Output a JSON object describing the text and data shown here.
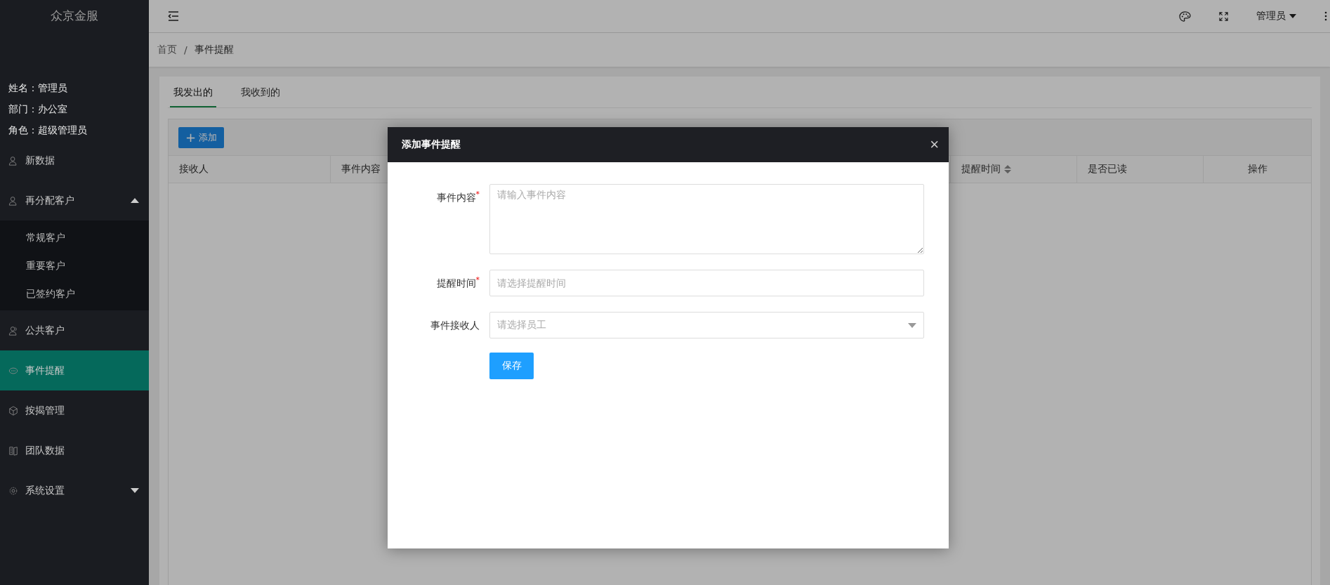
{
  "app": {
    "title": "众京金服"
  },
  "user_info": [
    {
      "label": "姓名：",
      "value": "管理员"
    },
    {
      "label": "部门：",
      "value": "办公室"
    },
    {
      "label": "角色：",
      "value": "超级管理员"
    }
  ],
  "menu": [
    {
      "label": "新数据",
      "selected": false
    },
    {
      "label": "再分配客户",
      "selected": false,
      "expanded": true,
      "children": [
        {
          "label": "常规客户",
          "selected": false
        },
        {
          "label": "重要客户",
          "selected": false
        },
        {
          "label": "已签约客户",
          "selected": false
        }
      ]
    },
    {
      "label": "公共客户",
      "selected": false
    },
    {
      "label": "事件提醒",
      "selected": true
    },
    {
      "label": "按揭管理",
      "selected": false
    },
    {
      "label": "团队数据",
      "selected": false
    },
    {
      "label": "系统设置",
      "selected": false,
      "expanded": false
    }
  ],
  "topbar": {
    "user": "管理员"
  },
  "breadcrumb": {
    "separator": "/",
    "items": [
      "首页",
      "事件提醒"
    ]
  },
  "tabs": [
    {
      "label": "我发出的",
      "selected": true
    },
    {
      "label": "我收到的",
      "selected": false
    }
  ],
  "add_button": {
    "icon": "+",
    "label": "添加"
  },
  "table": {
    "columns": [
      {
        "label": "接收人",
        "sortable": false
      },
      {
        "label": "事件内容",
        "sortable": false
      },
      {
        "label": "提醒时间",
        "sortable": true
      },
      {
        "label": "是否已读",
        "sortable": false
      },
      {
        "label": "操作",
        "sortable": false
      }
    ]
  },
  "modal": {
    "title": "添加事件提醒",
    "close": "×",
    "required_mark": "*",
    "fields": [
      {
        "kind": "textarea",
        "label": "事件内容",
        "required": true,
        "placeholder": "请输入事件内容"
      },
      {
        "kind": "input",
        "label": "提醒时间",
        "required": true,
        "placeholder": "请选择提醒时间"
      },
      {
        "kind": "select",
        "label": "事件接收人",
        "required": false,
        "placeholder": "请选择员工"
      }
    ],
    "save_button": "保存"
  }
}
